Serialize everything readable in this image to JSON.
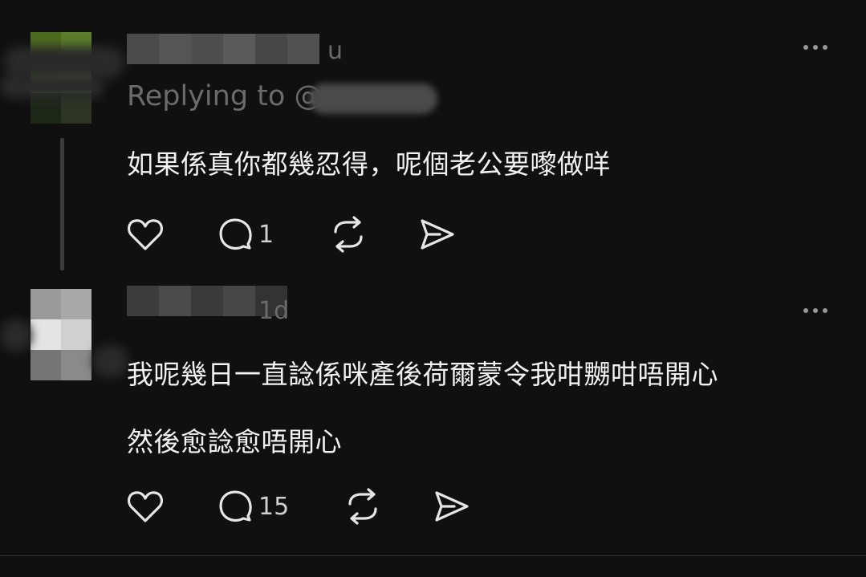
{
  "posts": [
    {
      "reply_prefix": "Replying to @",
      "paragraphs": [
        "如果係真你都幾忍得，呢個老公要嚟做咩"
      ],
      "reply_count": "1",
      "name_fragment": "u"
    },
    {
      "time": "1d",
      "paragraphs": [
        "我呢幾日一直諗係咪產後荷爾蒙令我咁嬲咁唔開心",
        "然後愈諗愈唔開心"
      ],
      "reply_count": "15"
    }
  ],
  "icons": {
    "like": "heart-icon",
    "comment": "comment-icon",
    "repost": "repost-icon",
    "share": "share-icon",
    "more": "more-icon"
  },
  "colors": {
    "background": "#101010",
    "text": "#f2f2f2",
    "muted": "#6b6b6b"
  }
}
